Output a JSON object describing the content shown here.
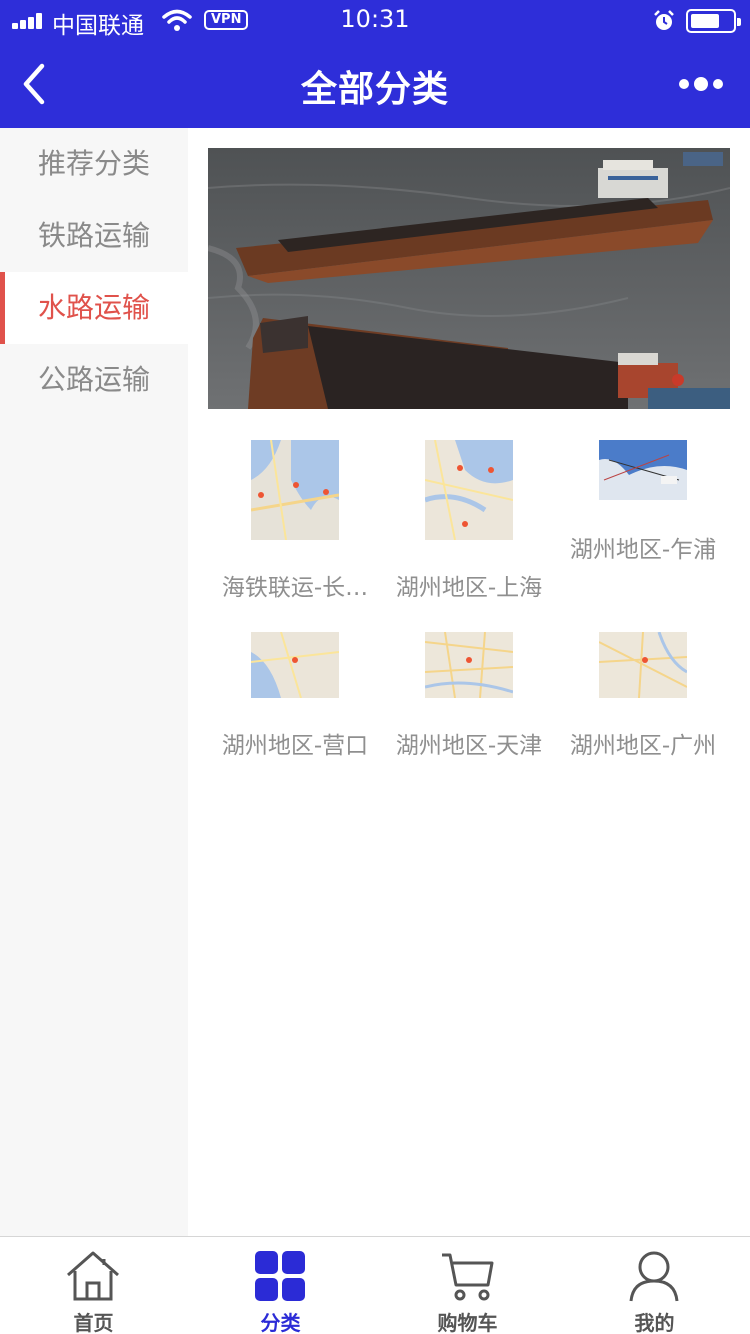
{
  "status_bar": {
    "carrier": "中国联通",
    "vpn": "VPN",
    "time": "10:31"
  },
  "navbar": {
    "title": "全部分类",
    "back_icon": "chevron-left-icon",
    "more_icon": "more-dots-icon"
  },
  "sidebar": {
    "items": [
      {
        "label": "推荐分类",
        "active": false
      },
      {
        "label": "铁路运输",
        "active": false
      },
      {
        "label": "水路运输",
        "active": true
      },
      {
        "label": "公路运输",
        "active": false
      }
    ],
    "active_color": "#e0524b"
  },
  "grid": {
    "items": [
      {
        "label": "海铁联运-长…"
      },
      {
        "label": "湖州地区-上海"
      },
      {
        "label": "湖州地区-乍浦"
      },
      {
        "label": "湖州地区-营口"
      },
      {
        "label": "湖州地区-天津"
      },
      {
        "label": "湖州地区-广州"
      }
    ]
  },
  "tabbar": {
    "tabs": [
      {
        "label": "首页",
        "icon": "home-icon",
        "active": false
      },
      {
        "label": "分类",
        "icon": "grid-icon",
        "active": true
      },
      {
        "label": "购物车",
        "icon": "cart-icon",
        "active": false
      },
      {
        "label": "我的",
        "icon": "user-icon",
        "active": false
      }
    ]
  },
  "colors": {
    "brand": "#2e2ed9",
    "active_tab": "#2b2bd6"
  }
}
